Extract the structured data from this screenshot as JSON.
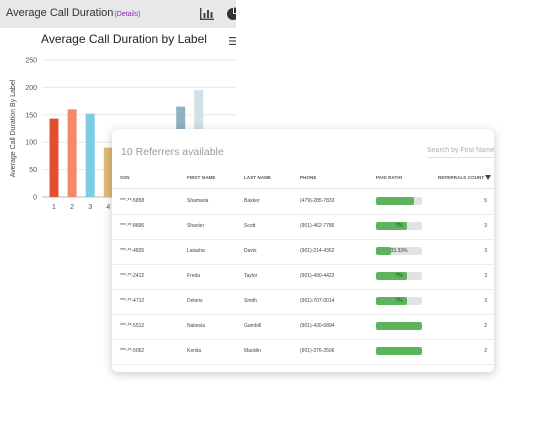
{
  "header": {
    "title": "Average Call Duration",
    "details_link": "(Details)"
  },
  "icons": {
    "bar_chart": "bar-chart-icon",
    "pie_chart": "pie-chart-icon",
    "menu": "hamburger-menu-icon",
    "sort": "sort-desc-icon"
  },
  "chart_data": {
    "type": "bar",
    "title": "Average Call Duration by Label",
    "ylabel": "Average Call Duration By Label",
    "xlabel": "",
    "ylim": [
      0,
      250
    ],
    "yticks": [
      0,
      50,
      100,
      150,
      200,
      250
    ],
    "categories": [
      "1",
      "2",
      "3",
      "4",
      "",
      "",
      "",
      "",
      ""
    ],
    "values": [
      143,
      160,
      152,
      90,
      0,
      0,
      0,
      165,
      195
    ],
    "colors": [
      "#e2502f",
      "#f4886a",
      "#7dcbe5",
      "#e0bb78",
      "#cccccc",
      "#cccccc",
      "#cccccc",
      "#8fb2c2",
      "#cfe2e8"
    ]
  },
  "referrers": {
    "title": "10 Referrers available",
    "search_placeholder": "Search by First Name",
    "columns": {
      "ssn": "SSN",
      "first_name": "FIRST NAME",
      "last_name": "LAST NAME",
      "phone": "PHONE",
      "paid_ratio": "PAID RATIO",
      "referrals_count": "REFERRALS COUNT"
    },
    "rows": [
      {
        "ssn": "***-**-5858",
        "first_name": "Shamaria",
        "last_name": "Basker",
        "phone": "(479)-285-7833",
        "paid_ratio": 0.82,
        "ratio_label": "",
        "count": "5"
      },
      {
        "ssn": "***-**-8896",
        "first_name": "Shanier",
        "last_name": "Scott",
        "phone": "(901)-462-7786",
        "paid_ratio": 0.68,
        "ratio_label": "7%",
        "count": "3"
      },
      {
        "ssn": "***-**-4835",
        "first_name": "Latasha",
        "last_name": "Davis",
        "phone": "(901)-214-4362",
        "paid_ratio": 0.33,
        "ratio_label": "33.33%",
        "count": "3"
      },
      {
        "ssn": "***-**-2412",
        "first_name": "Freda",
        "last_name": "Taylor",
        "phone": "(901)-490-4422",
        "paid_ratio": 0.68,
        "ratio_label": "7%",
        "count": "3"
      },
      {
        "ssn": "***-**-4712",
        "first_name": "Deloris",
        "last_name": "Smith",
        "phone": "(901)-707-0014",
        "paid_ratio": 0.68,
        "ratio_label": "7%",
        "count": "3"
      },
      {
        "ssn": "***-**-5512",
        "first_name": "Nakesia",
        "last_name": "Gambill",
        "phone": "(901)-430-6894",
        "paid_ratio": 1.0,
        "ratio_label": "",
        "count": "2"
      },
      {
        "ssn": "***-**-5062",
        "first_name": "Kenita",
        "last_name": "Macklin",
        "phone": "(901)-376-2506",
        "paid_ratio": 1.0,
        "ratio_label": "",
        "count": "2"
      }
    ]
  }
}
